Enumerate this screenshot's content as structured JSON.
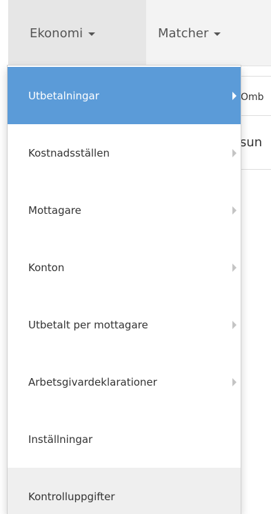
{
  "navbar": {
    "ekonomi_label": "Ekonomi",
    "matcher_label": "Matcher"
  },
  "background": {
    "tab_fragment": "Omb",
    "search_fragment": "sun"
  },
  "dropdown": {
    "items": [
      {
        "label": "Utbetalningar",
        "has_submenu": true,
        "state": "active"
      },
      {
        "label": "Kostnadsställen",
        "has_submenu": true
      },
      {
        "label": "Mottagare",
        "has_submenu": true
      },
      {
        "label": "Konton",
        "has_submenu": true
      },
      {
        "label": "Utbetalt per mottagare",
        "has_submenu": true
      },
      {
        "label": "Arbetsgivardeklarationer",
        "has_submenu": true
      },
      {
        "label": "Inställningar",
        "has_submenu": false
      },
      {
        "label": "Kontrolluppgifter",
        "has_submenu": false,
        "state": "hovered"
      }
    ]
  },
  "colors": {
    "active_bg": "#5b9bd8",
    "navbar_bg": "#f3f3f3",
    "hover_bg": "#efefef"
  }
}
